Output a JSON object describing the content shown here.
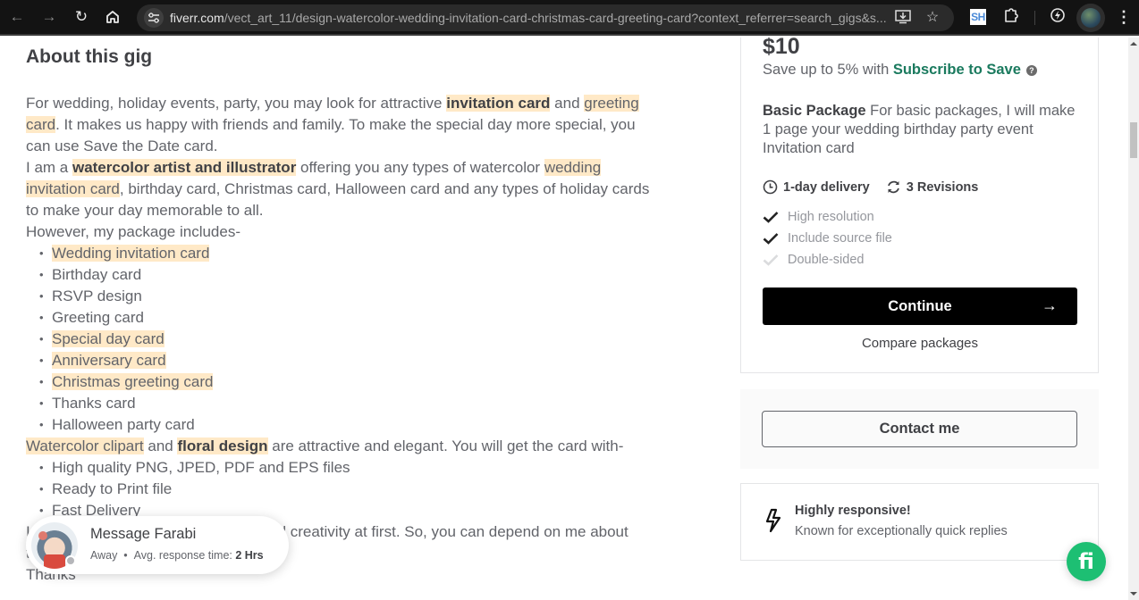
{
  "browser": {
    "url_host": "fiverr.com",
    "url_path": "/vect_art_11/design-watercolor-wedding-invitation-card-christmas-card-greeting-card?context_referrer=search_gigs&s...",
    "extension_label": "SH"
  },
  "about": {
    "title": "About this gig",
    "p1": [
      {
        "t": "For wedding, holiday events, party, you may look for attractive ",
        "s": ""
      },
      {
        "t": "invitation card",
        "s": "hl-b"
      },
      {
        "t": " and ",
        "s": ""
      },
      {
        "t": "greeting card",
        "s": "hl"
      },
      {
        "t": ". It makes us happy with friends and family. To make the special day more special, you can use Save the Date card.",
        "s": ""
      }
    ],
    "p2": [
      {
        "t": "I am a ",
        "s": ""
      },
      {
        "t": "watercolor artist and illustrator",
        "s": "hl-b"
      },
      {
        "t": " offering you any types of watercolor ",
        "s": ""
      },
      {
        "t": "wedding invitation card",
        "s": "hl"
      },
      {
        "t": ", birthday card, Christmas card, Halloween card and any types of holiday cards to make your day memorable to all.",
        "s": ""
      }
    ],
    "p3": "However, my package includes-",
    "package_items": [
      {
        "t": "Wedding invitation card",
        "s": "hl"
      },
      {
        "t": "Birthday card",
        "s": ""
      },
      {
        "t": "RSVP design",
        "s": ""
      },
      {
        "t": "Greeting card",
        "s": ""
      },
      {
        "t": "Special day card",
        "s": "hl"
      },
      {
        "t": "Anniversary card",
        "s": "hl"
      },
      {
        "t": "Christmas greeting card",
        "s": "hl"
      },
      {
        "t": "Thanks card",
        "s": ""
      },
      {
        "t": "Halloween party card",
        "s": ""
      }
    ],
    "p4": [
      {
        "t": "Watercolor clipart",
        "s": "hl"
      },
      {
        "t": " and ",
        "s": ""
      },
      {
        "t": "floral design",
        "s": "hl-b"
      },
      {
        "t": " are attractive and elegant. You will get the card with-",
        "s": ""
      }
    ],
    "deliverables": [
      {
        "t": "High quality PNG, JPED, PDF and EPS files",
        "s": ""
      },
      {
        "t": "Ready to Print file",
        "s": ""
      },
      {
        "t": "Fast Delivery",
        "s": ""
      }
    ],
    "p5": "I always prioritize your satisfaction and creativity at first. So, you can depend on me about the quality.",
    "p6": "Thanks"
  },
  "package": {
    "price": "$10",
    "save_prefix": "Save up to 5% with ",
    "save_link": "Subscribe to Save",
    "help_glyph": "?",
    "name": "Basic Package",
    "description": " For basic packages, I will make 1 page your wedding birthday party event Invitation card",
    "delivery": "1-day delivery",
    "revisions": "3 Revisions",
    "features": [
      {
        "label": "High resolution",
        "included": true
      },
      {
        "label": "Include source file",
        "included": true
      },
      {
        "label": "Double-sided",
        "included": false
      }
    ],
    "continue_label": "Continue",
    "continue_arrow": "→",
    "compare_label": "Compare packages"
  },
  "contact": {
    "label": "Contact me"
  },
  "responsive": {
    "title": "Highly responsive!",
    "subtitle": "Known for exceptionally quick replies"
  },
  "chat": {
    "name": "Message Farabi",
    "status": "Away",
    "separator": "•",
    "response_prefix": "Avg. response time: ",
    "response_value": "2 Hrs"
  },
  "fab": {
    "label": "fi"
  },
  "colors": {
    "brand_green": "#1dbf73",
    "link_green": "#1a7a5e",
    "highlight": "#ffe9c7"
  }
}
